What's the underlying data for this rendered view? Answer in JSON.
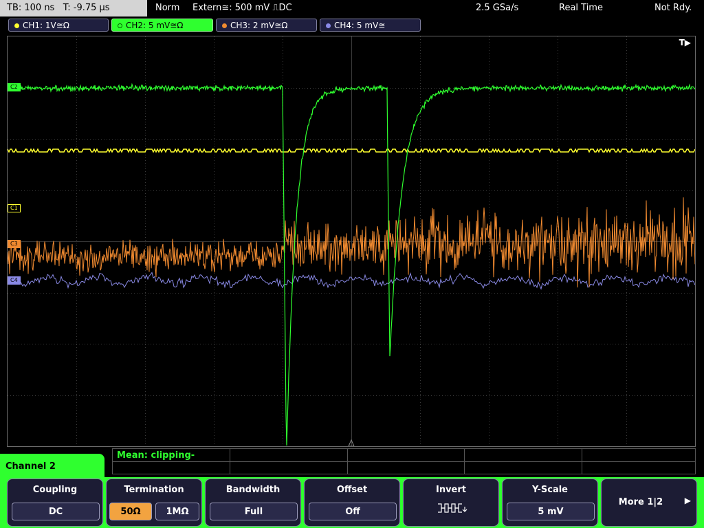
{
  "top_bar": {
    "timebase": "TB: 100 ns   T: -9.75 µs",
    "trigger_mode": "Norm",
    "trigger_source": "Extern≅: 500 mV ⎍DC",
    "sample_rate": "2.5 GSa/s",
    "acq_mode": "Real Time",
    "status": "Not Rdy."
  },
  "channels": [
    {
      "label": "CH1: 1V≅Ω",
      "color": "#ffff2f",
      "active": false
    },
    {
      "label": "CH2: 5 mV≅Ω",
      "color": "#2fff2f",
      "active": true
    },
    {
      "label": "CH3: 2 mV≅Ω",
      "color": "#f08a30",
      "active": false
    },
    {
      "label": "CH4: 5 mV≅",
      "color": "#8a8ae6",
      "active": false
    }
  ],
  "screen": {
    "trigger_indicator": "T▶",
    "markers": [
      {
        "label": "C2",
        "color": "#2fff2f"
      },
      {
        "label": "C1",
        "color": "#ffff2f"
      },
      {
        "label": "C3",
        "color": "#f08a30"
      },
      {
        "label": "C4",
        "color": "#8a8ae6"
      }
    ]
  },
  "measurement": {
    "text": "Mean: clipping-"
  },
  "menu": {
    "title": "Channel 2",
    "softkeys": [
      {
        "title": "Coupling",
        "value": "DC"
      },
      {
        "title": "Termination",
        "value": "50Ω",
        "value2": "1MΩ"
      },
      {
        "title": "Bandwidth",
        "value": "Full"
      },
      {
        "title": "Offset",
        "value": "Off"
      },
      {
        "title": "Invert",
        "icon": "invert-waveform-icon"
      },
      {
        "title": "Y-Scale",
        "value": "5 mV"
      },
      {
        "title": "More 1|2"
      }
    ]
  }
}
